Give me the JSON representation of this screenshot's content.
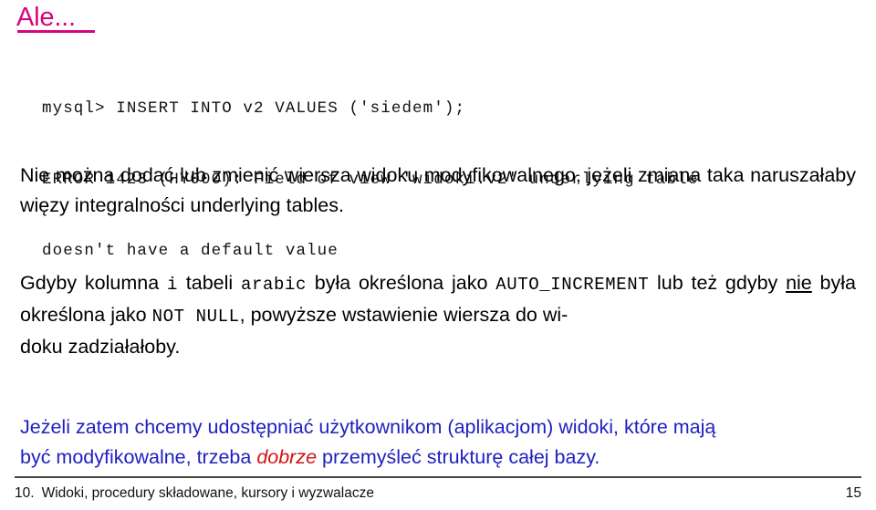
{
  "slide": {
    "title": "Ale...",
    "accent_color": "#D4067F",
    "body_color": "#000000",
    "highlight_blue": "#2020C0",
    "highlight_red": "#D41212"
  },
  "code_block": {
    "lines": [
      "mysql> INSERT INTO v2 VALUES ('siedem');",
      "ERROR 1423 (HY000): Field of view 'widoki.v2' underlying table",
      "doesn't have a default value"
    ]
  },
  "paragraph1": {
    "line1": "Nie można dodać lub zmienić wiersza widoku modyfikowalnego, jeżeli zmiana",
    "line2_a": "taka naruszałaby więzy integralności ",
    "line2_b": "underlying tables."
  },
  "paragraph2": {
    "s1": "Gdyby kolumna ",
    "code_i": "i",
    "s2": " tabeli ",
    "code_arabic": "arabic",
    "s3": " była określona jako ",
    "code_autoinc": "AUTO_INCREMENT",
    "s4": " lub też gdyby ",
    "underlined_nie": "nie",
    "s5": " była określona jako ",
    "code_notnull": "NOT NULL",
    "s6": ", powyższe wstawienie wiersza do wi-",
    "s7": "doku zadziałałoby."
  },
  "paragraph3": {
    "s1": "Jeżeli zatem chcemy udostępniać użytkownikom (aplikacjom) widoki, które mają",
    "s2": "być modyfikowalne, trzeba ",
    "emphasis": "dobrze",
    "s3": " przemyśleć strukturę całej bazy."
  },
  "footer": {
    "section_number": "10.",
    "section_title": "Widoki, procedury składowane, kursory i wyzwalacze",
    "page_number": "15"
  }
}
